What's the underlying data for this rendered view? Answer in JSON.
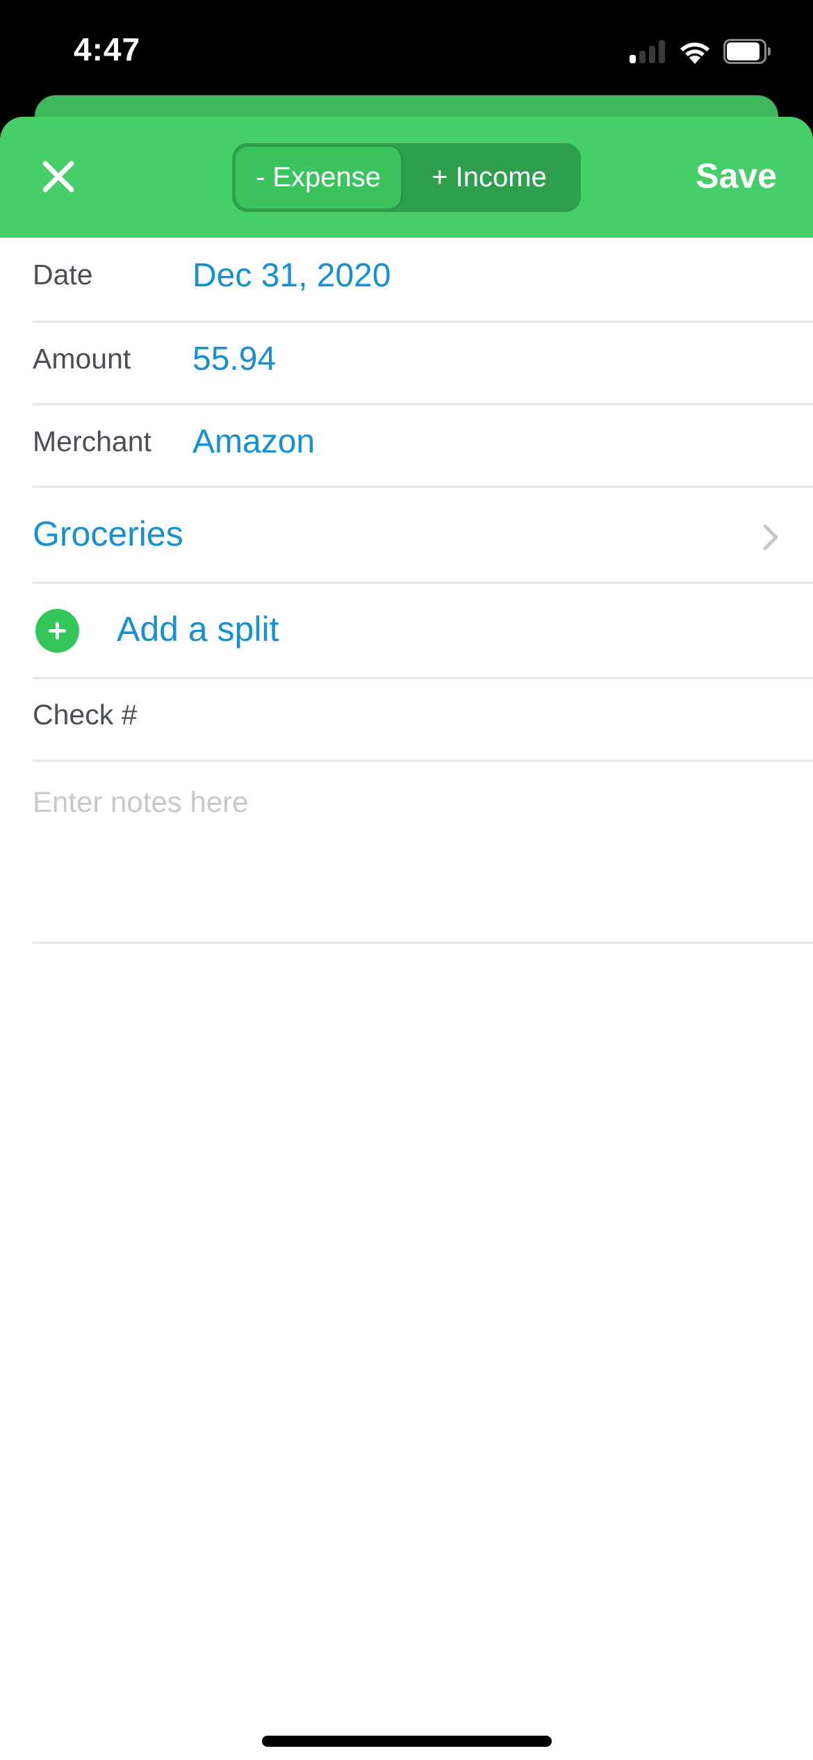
{
  "status_bar": {
    "time": "4:47",
    "signal_bars_filled": 1,
    "signal_bars_total": 4,
    "battery_level_percent": 90,
    "icons": [
      "signal-icon",
      "wifi-icon",
      "battery-icon"
    ]
  },
  "header": {
    "close_icon": "close-icon",
    "segmented": {
      "options": [
        {
          "label": "- Expense",
          "selected": true
        },
        {
          "label": "+ Income",
          "selected": false
        }
      ]
    },
    "save_label": "Save",
    "accent_color": "#46cf69"
  },
  "form": {
    "date": {
      "label": "Date",
      "value": "Dec 31, 2020"
    },
    "amount": {
      "label": "Amount",
      "value": "55.94"
    },
    "merchant": {
      "label": "Merchant",
      "value": "Amazon"
    },
    "category": {
      "value": "Groceries",
      "icon": "chevron-right-icon"
    },
    "split": {
      "label": "Add a split",
      "icon": "plus-circle-icon"
    },
    "check": {
      "label": "Check #",
      "value": ""
    },
    "notes": {
      "placeholder": "Enter notes here",
      "value": ""
    }
  },
  "colors": {
    "link_blue": "#1590d4",
    "label_gray": "#4a4f55",
    "add_green": "#34c659"
  }
}
